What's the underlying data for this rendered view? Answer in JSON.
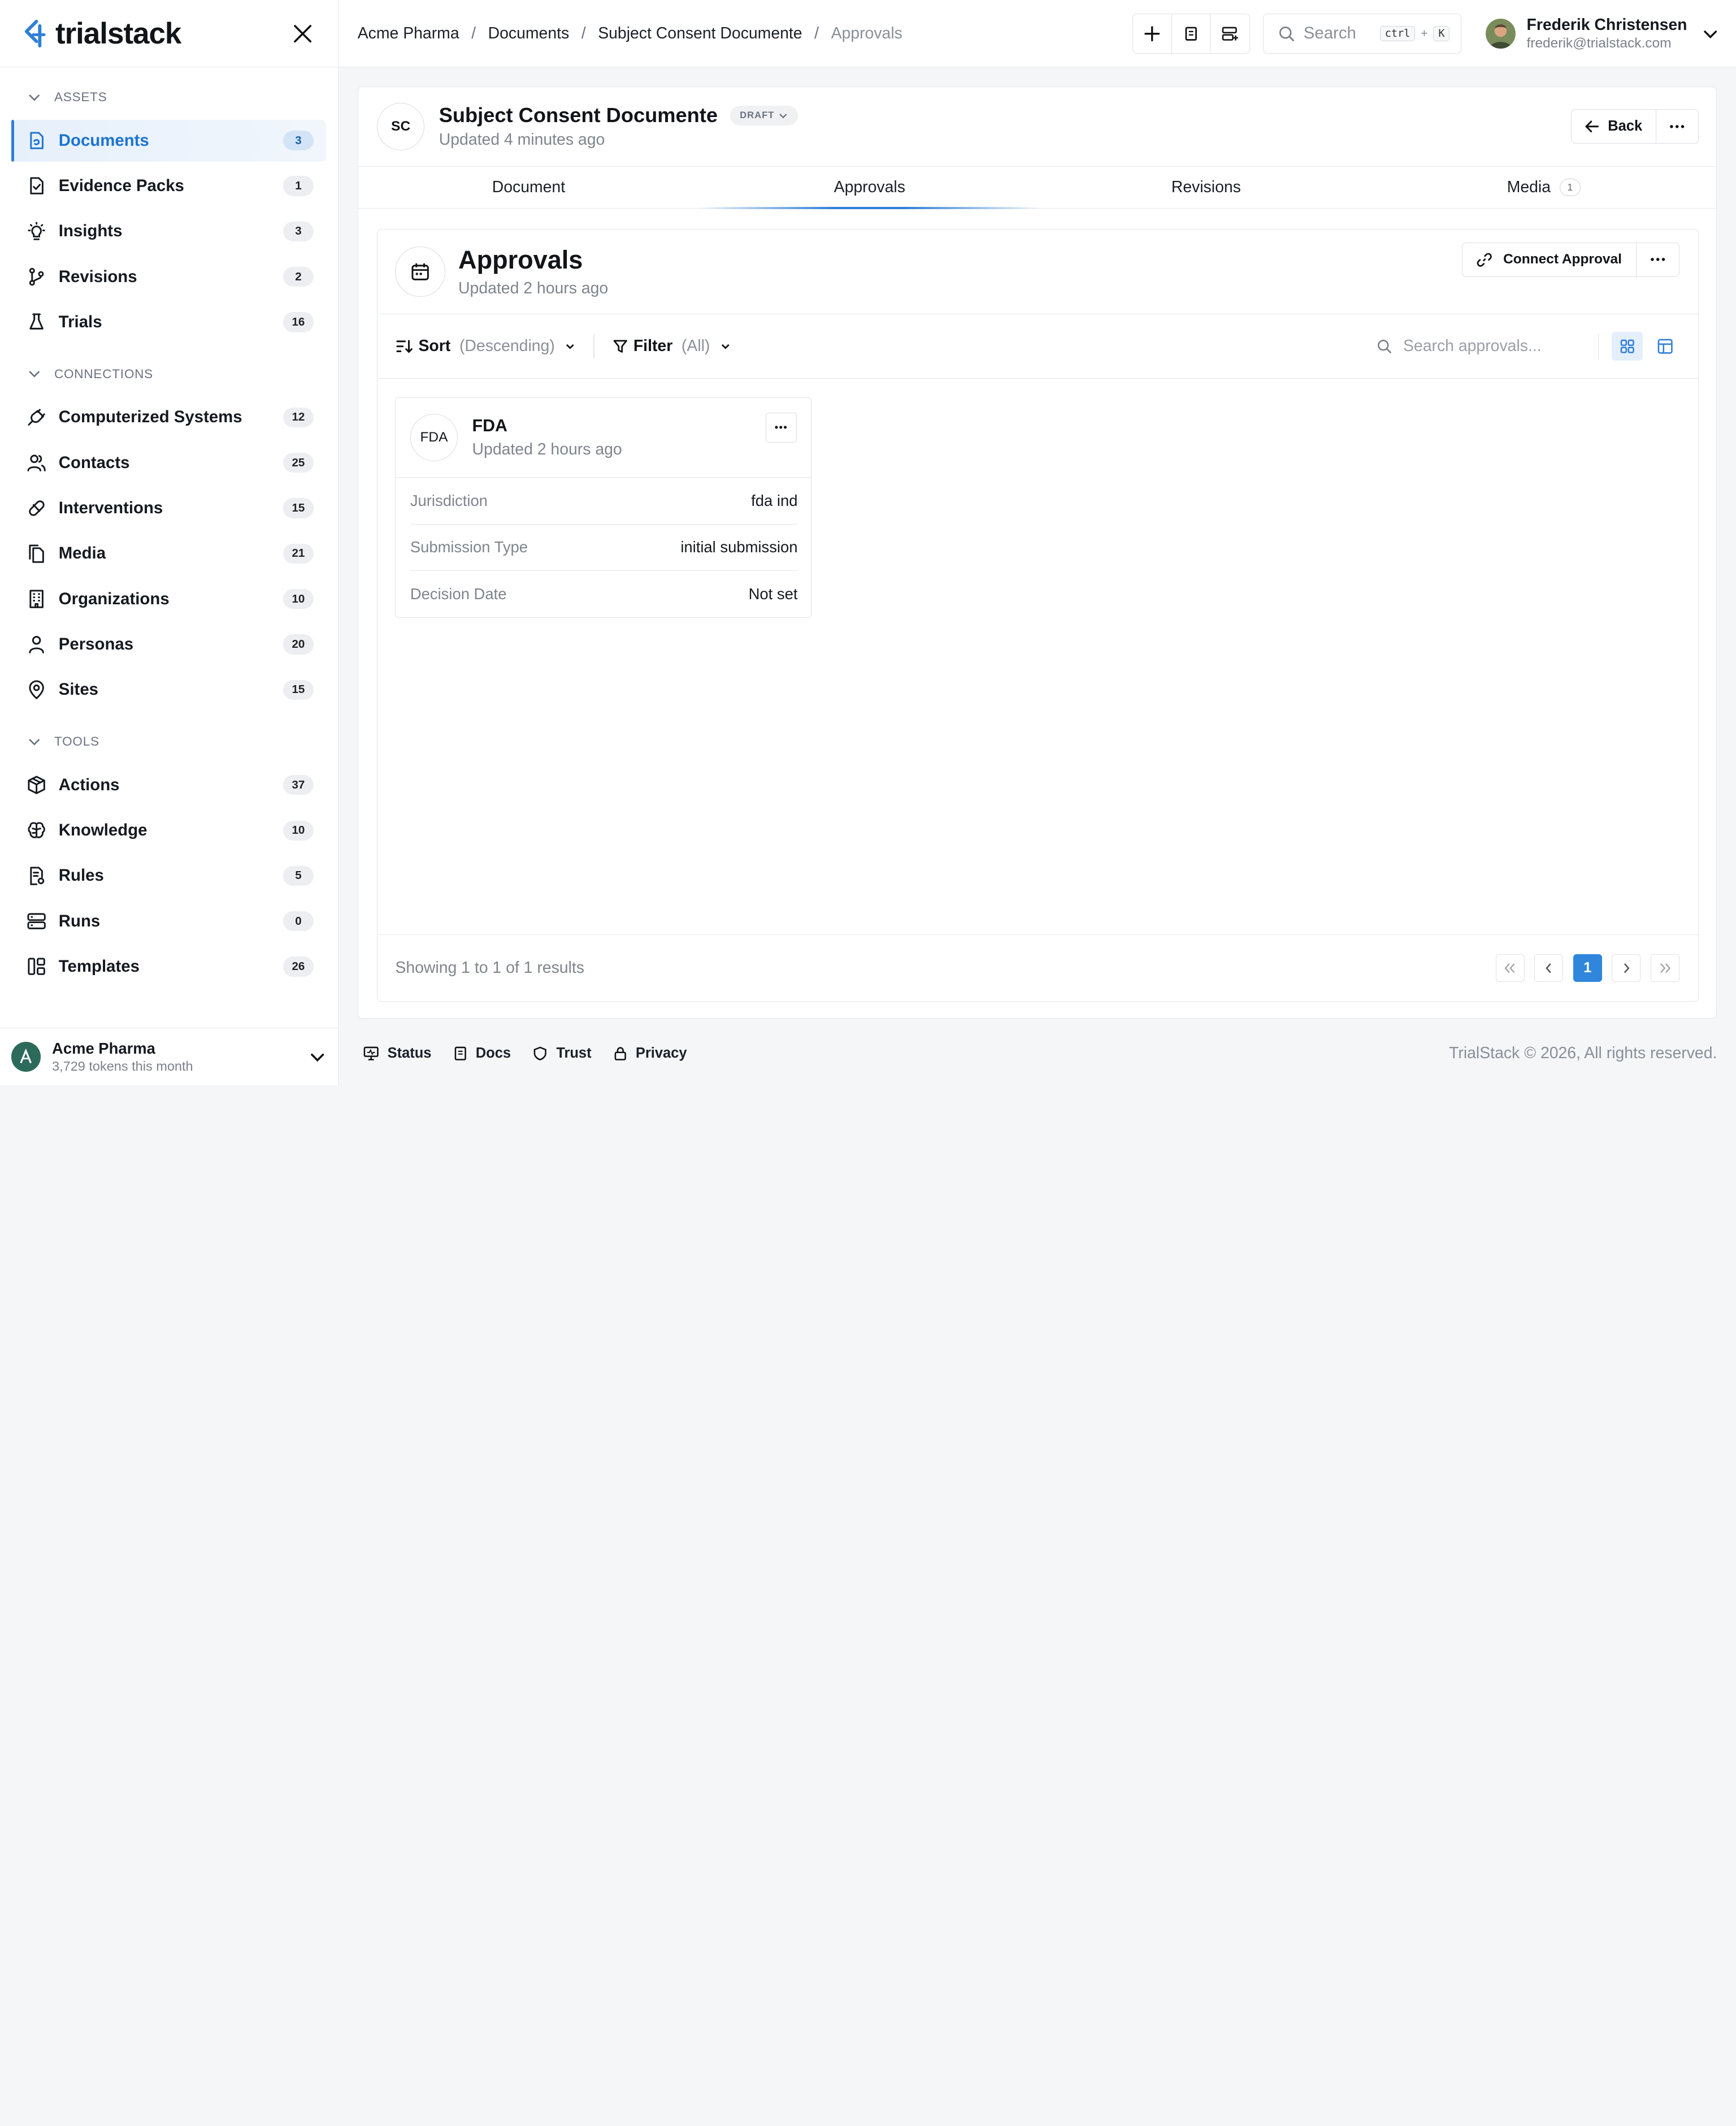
{
  "brand": {
    "name": "trialstack",
    "accent": "#2f7fd8"
  },
  "sidebar": {
    "sections": [
      {
        "label": "ASSETS",
        "items": [
          {
            "label": "Documents",
            "count": "3",
            "icon": "document-icon",
            "active": true
          },
          {
            "label": "Evidence Packs",
            "count": "1",
            "icon": "evidence-icon"
          },
          {
            "label": "Insights",
            "count": "3",
            "icon": "lightbulb-icon"
          },
          {
            "label": "Revisions",
            "count": "2",
            "icon": "branch-icon"
          },
          {
            "label": "Trials",
            "count": "16",
            "icon": "flask-icon"
          }
        ]
      },
      {
        "label": "CONNECTIONS",
        "items": [
          {
            "label": "Computerized Systems",
            "count": "12",
            "icon": "plug-icon"
          },
          {
            "label": "Contacts",
            "count": "25",
            "icon": "users-icon"
          },
          {
            "label": "Interventions",
            "count": "15",
            "icon": "pill-icon"
          },
          {
            "label": "Media",
            "count": "21",
            "icon": "files-icon"
          },
          {
            "label": "Organizations",
            "count": "10",
            "icon": "building-icon"
          },
          {
            "label": "Personas",
            "count": "20",
            "icon": "user-icon"
          },
          {
            "label": "Sites",
            "count": "15",
            "icon": "map-pin-icon"
          }
        ]
      },
      {
        "label": "TOOLS",
        "items": [
          {
            "label": "Actions",
            "count": "37",
            "icon": "package-icon"
          },
          {
            "label": "Knowledge",
            "count": "10",
            "icon": "brain-icon"
          },
          {
            "label": "Rules",
            "count": "5",
            "icon": "rules-icon"
          },
          {
            "label": "Runs",
            "count": "0",
            "icon": "server-icon"
          },
          {
            "label": "Templates",
            "count": "26",
            "icon": "template-icon"
          }
        ]
      }
    ],
    "footer": {
      "org": "Acme Pharma",
      "tokens": "3,729 tokens this month"
    }
  },
  "topbar": {
    "breadcrumbs": [
      "Acme Pharma",
      "Documents",
      "Subject Consent Documente",
      "Approvals"
    ],
    "search": {
      "placeholder": "Search",
      "key1": "ctrl",
      "plus": "+",
      "key2": "K"
    },
    "user": {
      "name": "Frederik Christensen",
      "email": "frederik@trialstack.com"
    }
  },
  "document": {
    "initials": "SC",
    "title": "Subject Consent Documente",
    "status": "DRAFT",
    "updated": "Updated 4 minutes ago",
    "back_label": "Back"
  },
  "tabs": [
    {
      "label": "Document"
    },
    {
      "label": "Approvals",
      "active": true
    },
    {
      "label": "Revisions"
    },
    {
      "label": "Media",
      "count": "1"
    }
  ],
  "approvals": {
    "title": "Approvals",
    "updated": "Updated 2 hours ago",
    "connect_label": "Connect Approval",
    "sort_label": "Sort",
    "sort_value": "(Descending)",
    "filter_label": "Filter",
    "filter_value": "(All)",
    "search_placeholder": "Search approvals...",
    "view_mode": "grid",
    "cards": [
      {
        "initials": "FDA",
        "title": "FDA",
        "updated": "Updated 2 hours ago",
        "fields": [
          {
            "key": "Jurisdiction",
            "value": "fda ind"
          },
          {
            "key": "Submission Type",
            "value": "initial submission"
          },
          {
            "key": "Decision Date",
            "value": "Not set"
          }
        ]
      }
    ],
    "showing": "Showing 1 to 1 of 1 results",
    "current_page": "1"
  },
  "footer": {
    "links": [
      {
        "label": "Status",
        "icon": "monitor-icon"
      },
      {
        "label": "Docs",
        "icon": "book-icon"
      },
      {
        "label": "Trust",
        "icon": "shield-icon"
      },
      {
        "label": "Privacy",
        "icon": "lock-icon"
      }
    ],
    "copyright": "TrialStack © 2026, All rights reserved."
  }
}
